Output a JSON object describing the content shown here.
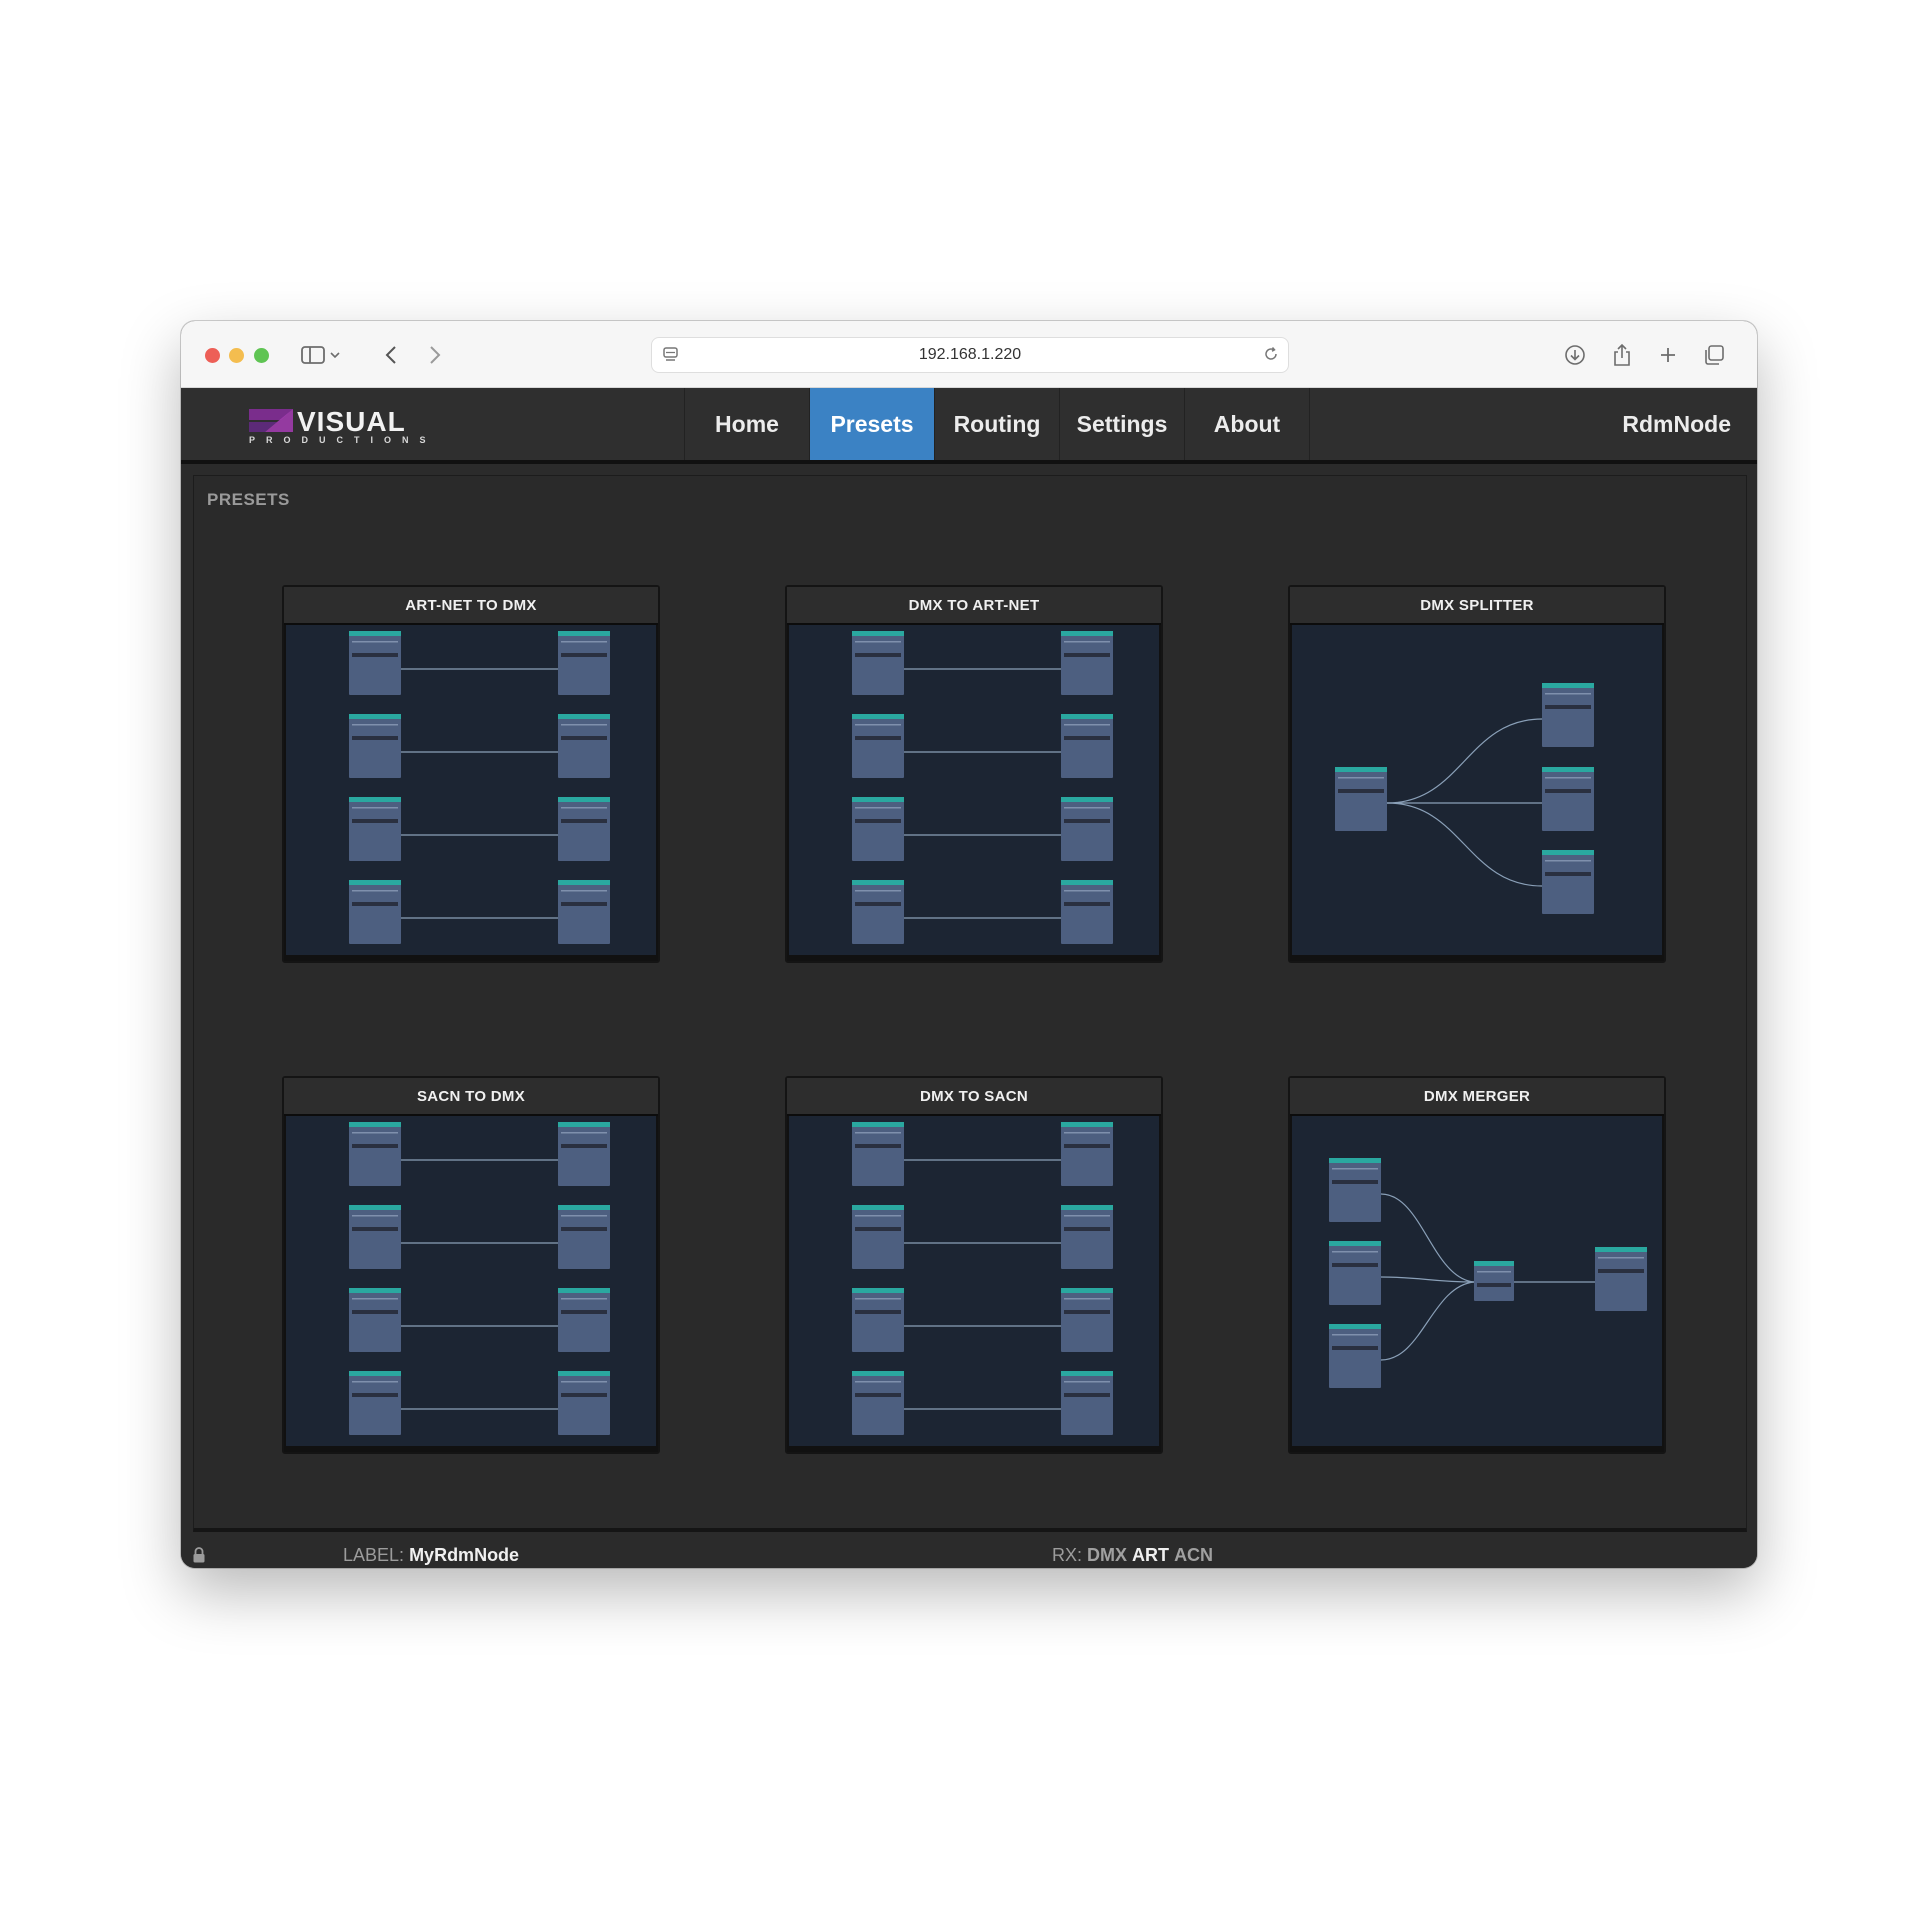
{
  "browser": {
    "url": "192.168.1.220"
  },
  "app": {
    "logo_text": "VISUAL",
    "logo_sub": "PRODUCTIONS",
    "nav": [
      {
        "label": "Home",
        "active": false
      },
      {
        "label": "Presets",
        "active": true
      },
      {
        "label": "Routing",
        "active": false
      },
      {
        "label": "Settings",
        "active": false
      },
      {
        "label": "About",
        "active": false
      }
    ],
    "device_name": "RdmNode",
    "accent_color": "#3b82c4"
  },
  "presets": {
    "section_title": "PRESETS",
    "cards": [
      {
        "title": "ART-NET TO DMX"
      },
      {
        "title": "DMX TO ART-NET"
      },
      {
        "title": "DMX SPLITTER"
      },
      {
        "title": "SACN TO DMX"
      },
      {
        "title": "DMX TO SACN"
      },
      {
        "title": "DMX MERGER"
      }
    ]
  },
  "footer": {
    "label_key": "LABEL:",
    "label_value": "MyRdmNode",
    "rx_key": "RX:",
    "rx_items": [
      {
        "label": "DMX",
        "active": false
      },
      {
        "label": "ART",
        "active": true
      },
      {
        "label": "ACN",
        "active": false
      }
    ]
  }
}
